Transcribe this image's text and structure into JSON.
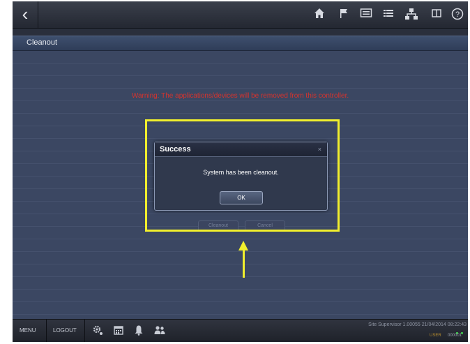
{
  "topbar": {
    "back_icon": "chevron-left-icon",
    "icons": [
      "home-icon",
      "flag-icon",
      "monitor-icon",
      "list-icon",
      "network-icon",
      "book-icon",
      "help-icon"
    ]
  },
  "page": {
    "title": "Cleanout",
    "warning": "Warning: The applications/devices will be removed from this controller."
  },
  "dialog": {
    "title": "Success",
    "close": "×",
    "message": "System has been cleanout.",
    "ok_label": "OK"
  },
  "behind_buttons": {
    "cleanout_label": "Cleanout",
    "cancel_label": "Cancel"
  },
  "bottombar": {
    "menu_label": "MENU",
    "logout_label": "LOGOUT",
    "status_text": "Site Supervisor 1.00055 21/04/2014 08:22:43",
    "user_label": "USER",
    "code_label": "000001"
  },
  "colors": {
    "warning": "#d6332d",
    "highlight": "#f1ef2d",
    "accent": "#3e4f6e"
  }
}
